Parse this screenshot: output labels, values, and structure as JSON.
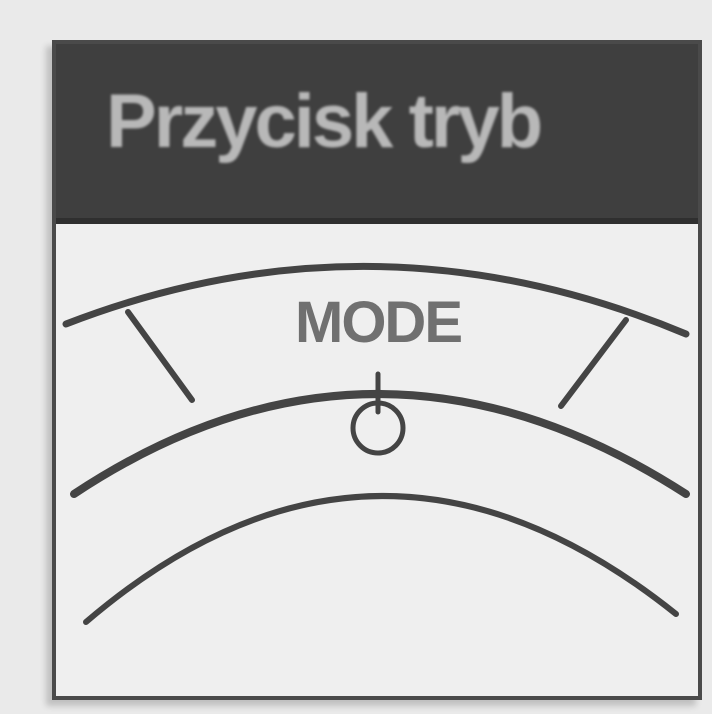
{
  "header": {
    "title": "Przycisk tryb"
  },
  "dial": {
    "label": "MODE",
    "button_icon": "mode-button-icon"
  },
  "colors": {
    "header_bg": "#3f3f3f",
    "header_text": "#b8b8b8",
    "panel_bg": "#efefef",
    "line": "#444444",
    "label": "#707070"
  }
}
